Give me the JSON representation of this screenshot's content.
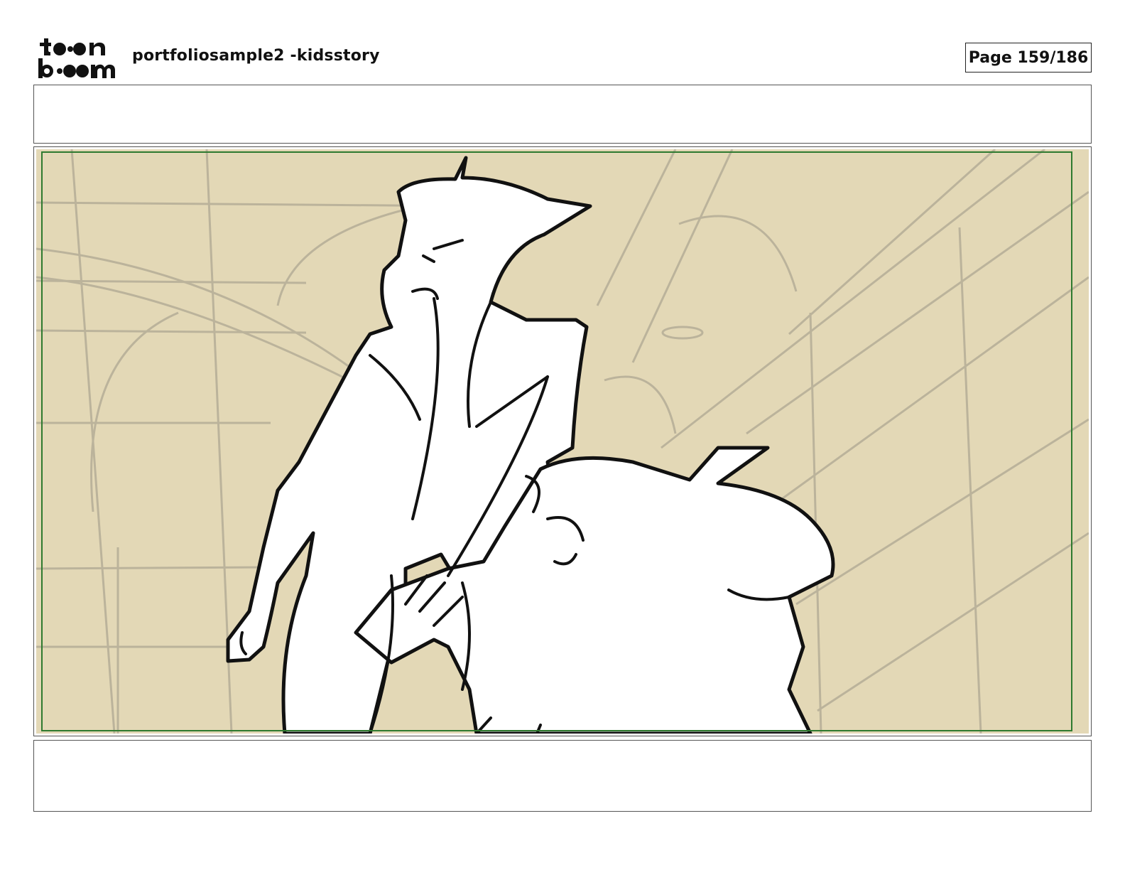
{
  "header": {
    "logo": {
      "icon": "toonboom-logo-icon",
      "line1": "to•n",
      "line2": "b••m"
    },
    "project_title": "portfoliosample2 -kidsstory",
    "page_indicator": "Page 159/186"
  },
  "panel": {
    "dialogue_text": "",
    "action_notes": "",
    "image": {
      "icon": "storyboard-sketch-image",
      "background_color": "#e3d8b6",
      "safe_area_color": "#2f7a2f"
    }
  }
}
